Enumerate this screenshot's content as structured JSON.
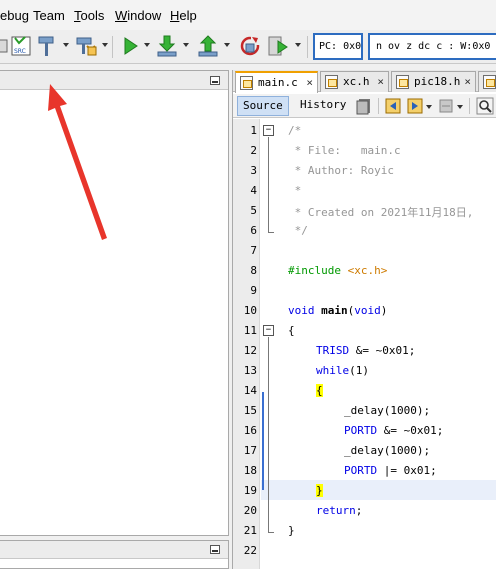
{
  "menubar": {
    "items": [
      {
        "pre": "",
        "ul": "",
        "post": "ebug"
      },
      {
        "pre": "Tea",
        "ul": "",
        "post": "m"
      },
      {
        "pre": "",
        "ul": "T",
        "post": "ools"
      },
      {
        "pre": "",
        "ul": "W",
        "post": "indow"
      },
      {
        "pre": "",
        "ul": "H",
        "post": "elp"
      }
    ]
  },
  "toolbar": {
    "pc_label": "PC: 0x0",
    "status_flags": "n ov z dc c  : W:0x0"
  },
  "tabs": [
    {
      "label": "main.c",
      "close": "×"
    },
    {
      "label": "xc.h",
      "close": "×"
    },
    {
      "label": "pic18.h",
      "close": "×"
    }
  ],
  "editor_toolbar": {
    "source": "Source",
    "history": "History"
  },
  "code": {
    "line_numbers": [
      "1",
      "2",
      "3",
      "4",
      "5",
      "6",
      "7",
      "8",
      "9",
      "10",
      "11",
      "12",
      "13",
      "14",
      "15",
      "16",
      "17",
      "18",
      "19",
      "20",
      "21",
      "22"
    ],
    "comment_open": "/*",
    "file_label": " * File:   main.c",
    "author_label": " * Author: Royic",
    "star": " *",
    "created": " * Created on 2021年11月18日, ",
    "comment_close": " */",
    "include_kw": "#include",
    "include_file": "<xc.h>",
    "void1": "void",
    "main_fn": "main",
    "void_param": "void",
    "brace_open": "{",
    "trisd": "TRISD",
    "trisd_rest": " &= ~0x01;",
    "while_kw": "while",
    "while_rest": "(1)",
    "delay1": "_delay(1000);",
    "portd1": "PORTD",
    "portd1_rest": " &= ~0x01;",
    "delay2": "_delay(1000);",
    "portd2": "PORTD",
    "portd2_rest": " |= 0x01;",
    "brace_close_inner": "}",
    "return_kw": "return",
    "return_rest": ";",
    "brace_close": "}"
  },
  "colors": {
    "keyword": "#0000e6",
    "comment": "#969696",
    "preprocessor": "#009900",
    "include_path": "#ce7b00",
    "brace_highlight": "#ffff00",
    "annotation_arrow": "#e8352b",
    "register_box_border": "#2d6cc0"
  }
}
